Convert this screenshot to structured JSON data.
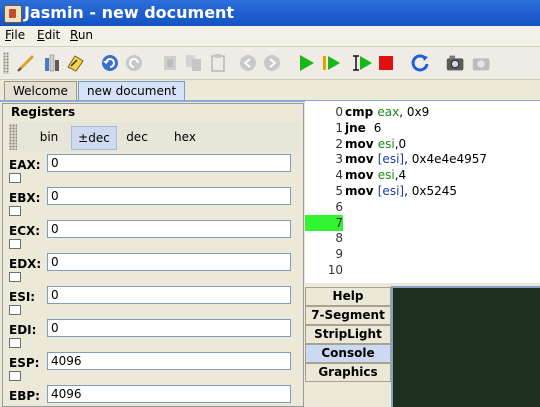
{
  "window": {
    "title": "Jasmin - new document"
  },
  "menu": {
    "items": [
      "File",
      "Edit",
      "Run"
    ]
  },
  "tabs": {
    "items": [
      "Welcome",
      "new document"
    ],
    "active": "new document"
  },
  "registers": {
    "heading": "Registers",
    "base_buttons": [
      "bin",
      "±dec",
      "dec",
      "hex"
    ],
    "selected_base": "±dec",
    "list": [
      {
        "name": "EAX:",
        "value": "0"
      },
      {
        "name": "EBX:",
        "value": "0"
      },
      {
        "name": "ECX:",
        "value": "0"
      },
      {
        "name": "EDX:",
        "value": "0"
      },
      {
        "name": "ESI:",
        "value": "0"
      },
      {
        "name": "EDI:",
        "value": "0"
      },
      {
        "name": "ESP:",
        "value": "4096"
      },
      {
        "name": "EBP:",
        "value": "4096"
      }
    ]
  },
  "editor": {
    "line_numbers": [
      "0",
      "1",
      "2",
      "3",
      "4",
      "5",
      "6",
      "7",
      "8",
      "9",
      "10"
    ],
    "highlighted_line": "7",
    "code": [
      {
        "op": "cmp",
        "args": [
          [
            "reg",
            "eax"
          ],
          [
            "txt",
            ", 0x9"
          ]
        ]
      },
      {
        "op": "jne",
        "args": [
          [
            "txt",
            " 6"
          ]
        ]
      },
      {
        "op": "mov",
        "args": [
          [
            "reg",
            "esi"
          ],
          [
            "txt",
            ",0"
          ]
        ]
      },
      {
        "op": "mov",
        "args": [
          [
            "br",
            "[esi]"
          ],
          [
            "txt",
            ", 0x4e4e4957"
          ]
        ]
      },
      {
        "op": "mov",
        "args": [
          [
            "reg",
            "esi"
          ],
          [
            "txt",
            ",4"
          ]
        ]
      },
      {
        "op": "mov",
        "args": [
          [
            "br",
            "[esi]"
          ],
          [
            "txt",
            ", 0x5245"
          ]
        ]
      }
    ]
  },
  "side_tabs": {
    "items": [
      "Help",
      "7-Segment",
      "StripLight",
      "Console",
      "Graphics"
    ],
    "active": "Console"
  },
  "colors": {
    "current_line": "#32f532",
    "console_bg": "#1f2f1f",
    "register_token": "#1a8a1a"
  }
}
